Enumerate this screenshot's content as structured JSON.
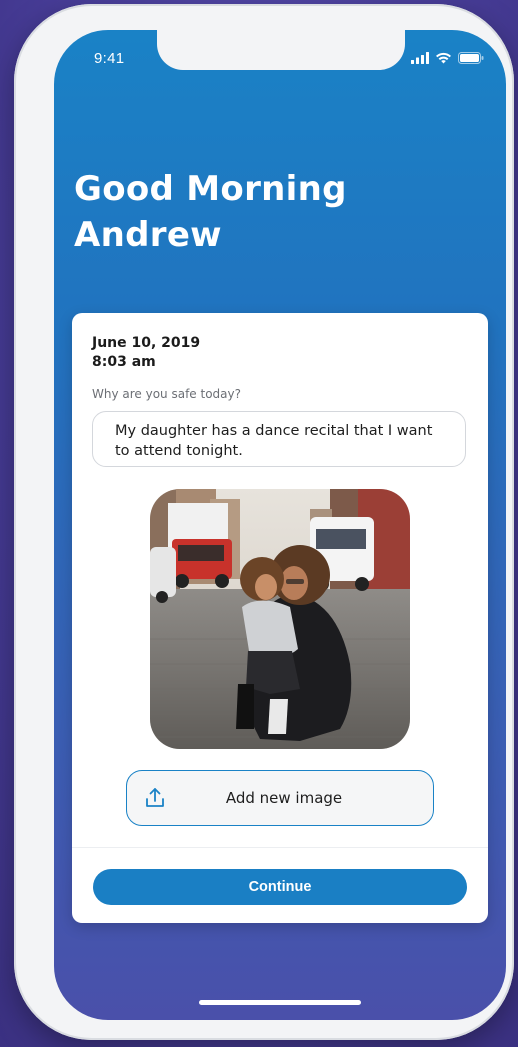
{
  "status_bar": {
    "time": "9:41",
    "icons": [
      "signal-icon",
      "wifi-icon",
      "battery-icon"
    ]
  },
  "greeting": {
    "line1": "Good Morning",
    "line2": "Andrew"
  },
  "entry": {
    "date": "June 10, 2019",
    "time": "8:03 am",
    "prompt": "Why are you safe today?",
    "answer": "My daughter has a dance recital that I want to attend tonight."
  },
  "photo": {
    "icon": "photo-mother-and-daughter"
  },
  "actions": {
    "add_image_label": "Add new image",
    "add_image_icon": "upload-icon",
    "continue_label": "Continue"
  },
  "colors": {
    "primary": "#1a7fc4",
    "background": "#4a3f9c"
  }
}
